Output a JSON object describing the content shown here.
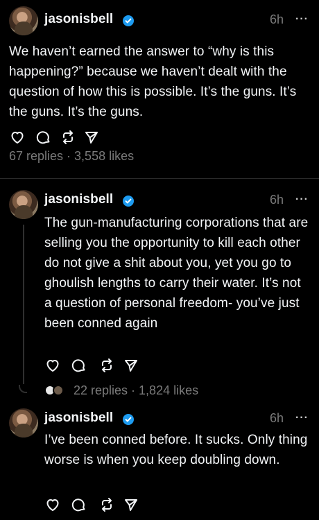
{
  "posts": [
    {
      "username": "jasonisbell",
      "time": "6h",
      "more": "···",
      "text": "We haven’t earned the answer to “why is this happening?” because we haven’t dealt with the question of how this is possible. It’s the guns. It’s the guns. It’s the guns.",
      "stats": "67 replies · 3,558 likes"
    },
    {
      "username": "jasonisbell",
      "time": "6h",
      "more": "···",
      "text": "The gun-manufacturing corporations that are selling you the opportunity to kill each other do not give a shit about you, yet you go to ghoulish lengths to carry their water. It’s not a question of personal freedom- you’ve just been conned again",
      "stats": "22 replies · 1,824 likes"
    },
    {
      "username": "jasonisbell",
      "time": "6h",
      "more": "···",
      "text": "I’ve been conned before. It sucks. Only thing worse is when you keep doubling down."
    }
  ],
  "colors": {
    "background": "#000000",
    "text": "#f3f5f7",
    "muted": "#7a7a7a",
    "verified": "#1d9bf0"
  }
}
